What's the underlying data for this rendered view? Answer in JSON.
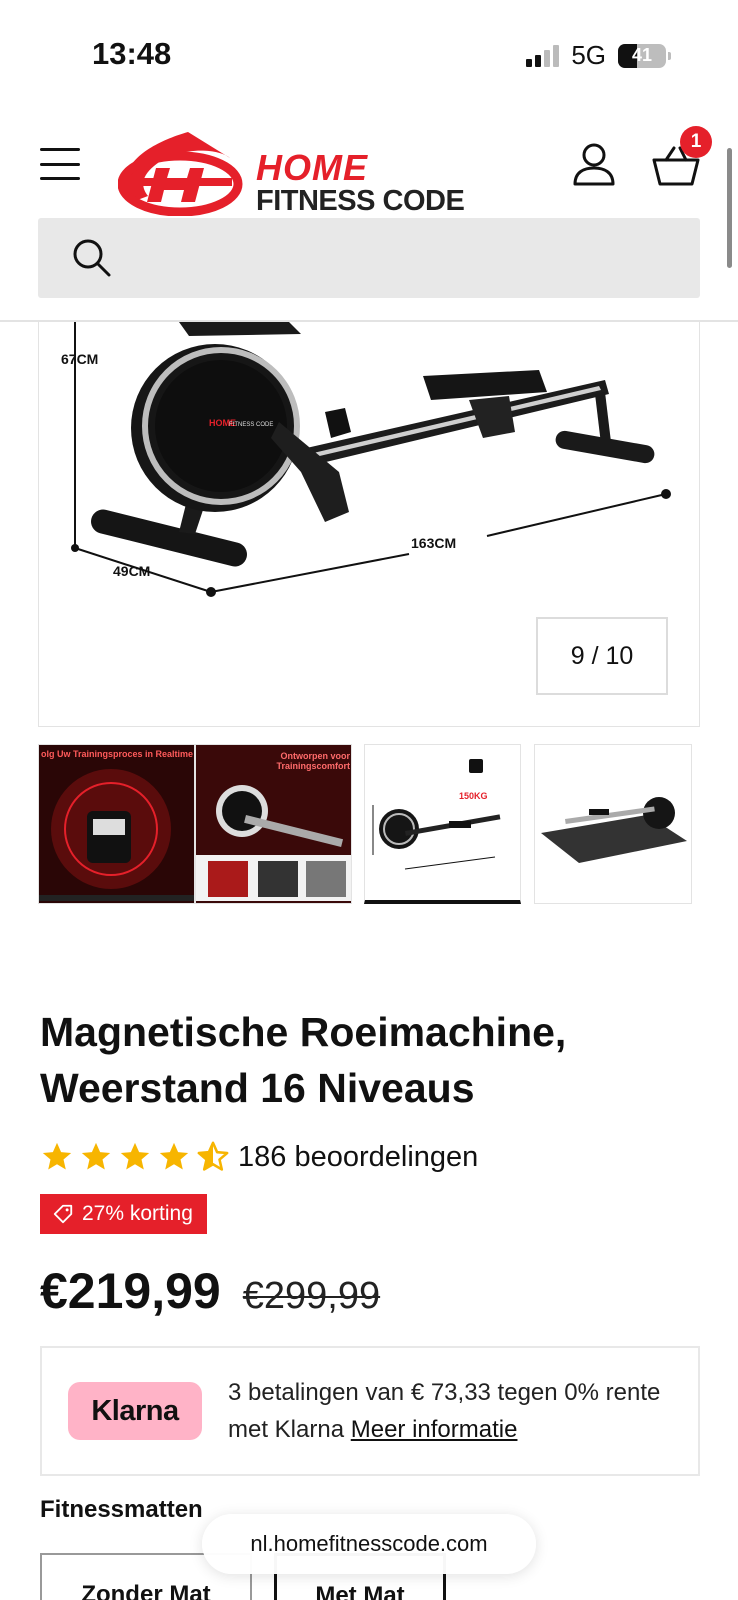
{
  "status": {
    "time": "13:48",
    "network": "5G",
    "battery": "41"
  },
  "header": {
    "logo_home": "HOME",
    "logo_fitness_code": "FITNESS CODE",
    "cart_count": "1",
    "search_placeholder": ""
  },
  "gallery": {
    "counter": "9 / 10",
    "dimensions": {
      "height": "67CM",
      "width": "49CM",
      "length": "163CM"
    },
    "thumbs": [
      {
        "caption": "olg Uw Trainingsproces in Realtime"
      },
      {
        "caption": "Ontworpen voor Trainingscomfort"
      },
      {
        "caption": "150KG"
      },
      {
        "caption": ""
      }
    ]
  },
  "product": {
    "title": "Magnetische Roeimachine, Weerstand 16 Niveaus",
    "rating": 4.5,
    "reviews": "186 beoordelingen",
    "discount": "27% korting",
    "price": "€219,99",
    "old_price": "€299,99"
  },
  "klarna": {
    "logo": "Klarna",
    "text": "3 betalingen van € 73,33 tegen 0% rente met Klarna",
    "link": "Meer informatie"
  },
  "variants": {
    "title": "Fitnessmatten",
    "options": [
      "Zonder Mat",
      "Met Mat"
    ],
    "selected": "Met Mat"
  },
  "browser": {
    "url": "nl.homefitnesscode.com"
  },
  "colors": {
    "brand_red": "#e5202a",
    "klarna_pink": "#ffb3c7",
    "star_yellow": "#f7b500"
  }
}
